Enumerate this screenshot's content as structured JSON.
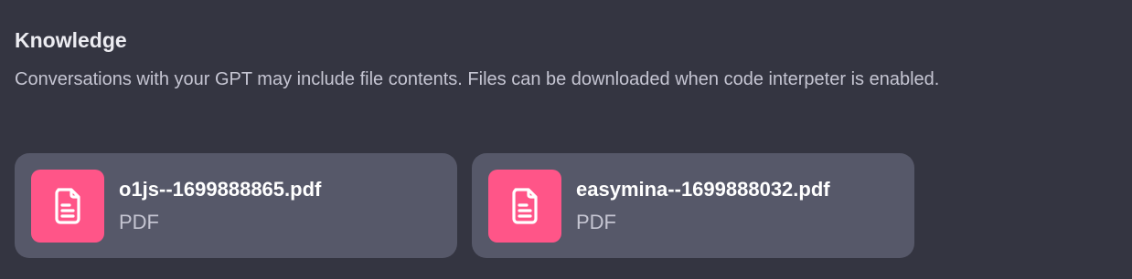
{
  "knowledge": {
    "title": "Knowledge",
    "description": "Conversations with your GPT may include file contents. Files can be downloaded when code interpeter is enabled.",
    "files": [
      {
        "name": "o1js--1699888865.pdf",
        "type": "PDF",
        "icon": "document-icon"
      },
      {
        "name": "easymina--1699888032.pdf",
        "type": "PDF",
        "icon": "document-icon"
      }
    ]
  },
  "colors": {
    "background": "#343541",
    "card": "#565869",
    "icon_accent": "#ff5588"
  }
}
